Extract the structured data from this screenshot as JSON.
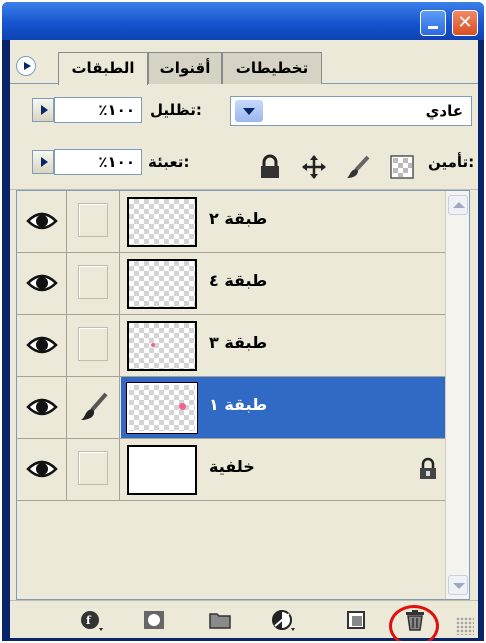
{
  "window": {
    "close_glyph": "✕"
  },
  "tabs": [
    {
      "label": "الطبقات",
      "active": true
    },
    {
      "label": "أقنوات",
      "active": false
    },
    {
      "label": "تخطيطات",
      "active": false
    }
  ],
  "blend": {
    "mode": "عادي"
  },
  "opacity": {
    "label": "تظليل:",
    "value": "٪١٠٠"
  },
  "lock": {
    "label": "تأمين:",
    "icons": [
      "lock-transparency-icon",
      "lock-paint-icon",
      "lock-move-icon",
      "lock-all-icon"
    ]
  },
  "fill": {
    "label": "تعبئة:",
    "value": "٪١٠٠"
  },
  "layers": [
    {
      "name": "طبقة ٢",
      "visible": true,
      "selected": false,
      "transparent": true
    },
    {
      "name": "طبقة ٤",
      "visible": true,
      "selected": false,
      "transparent": true
    },
    {
      "name": "طبقة ٣",
      "visible": true,
      "selected": false,
      "transparent": true
    },
    {
      "name": "طبقة ١",
      "visible": true,
      "selected": true,
      "transparent": true
    },
    {
      "name": "خلفية",
      "visible": true,
      "selected": false,
      "transparent": false,
      "locked": true
    }
  ],
  "bottom_icons": [
    "layer-style-icon",
    "layer-mask-icon",
    "new-group-icon",
    "adjustment-layer-icon",
    "new-layer-icon",
    "trash-icon"
  ],
  "colors": {
    "selection": "#316ac5",
    "highlight_circle": "#e01010",
    "title_bar": "#1452cc"
  }
}
